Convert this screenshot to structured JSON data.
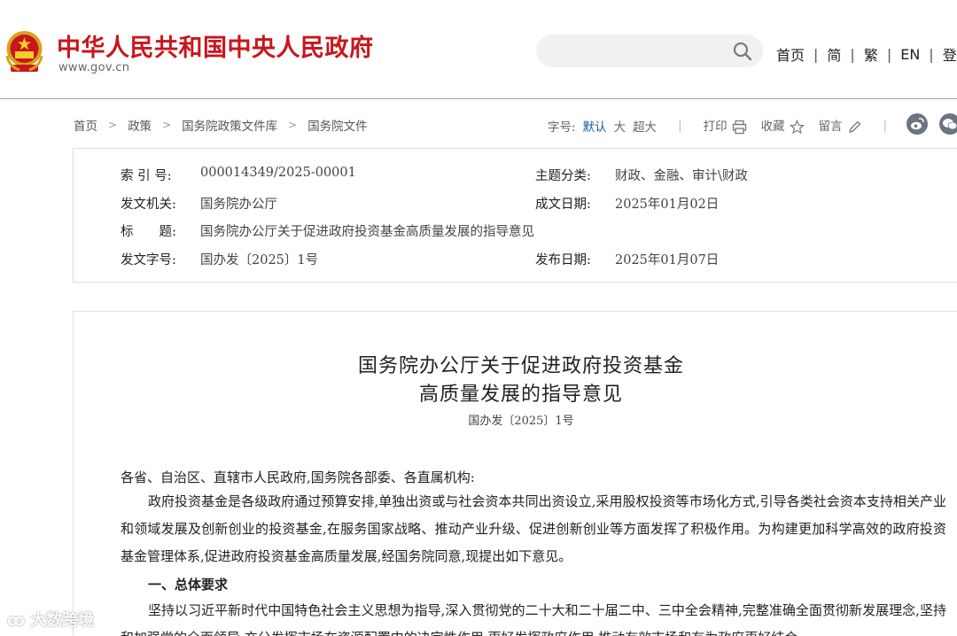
{
  "header": {
    "site_title": "中华人民共和国中央人民政府",
    "site_url": "www.gov.cn",
    "search": {
      "placeholder": ""
    },
    "links": [
      "首页",
      "简",
      "繁",
      "EN",
      "登录"
    ],
    "brand_color": "#c8161d"
  },
  "breadcrumb": [
    "首页",
    "政策",
    "国务院政策文件库",
    "国务院文件"
  ],
  "toolbar": {
    "font_size_label": "字号:",
    "font_default": "默认",
    "font_large": "大",
    "font_xlarge": "超大",
    "print": "打印",
    "favorite": "收藏",
    "comment": "留言"
  },
  "info": {
    "index_label": "索 引 号:",
    "index_value": "000014349/2025-00001",
    "topic_label": "主题分类:",
    "topic_value": "财政、金融、审计\\财政",
    "issuer_label": "发文机关:",
    "issuer_value": "国务院办公厅",
    "written_label": "成文日期:",
    "written_value": "2025年01月02日",
    "title_label": "标　　题:",
    "title_value": "国务院办公厅关于促进政府投资基金高质量发展的指导意见",
    "docno_label": "发文字号:",
    "docno_value": "国办发〔2025〕1号",
    "published_label": "发布日期:",
    "published_value": "2025年01月07日"
  },
  "article": {
    "title_line1": "国务院办公厅关于促进政府投资基金",
    "title_line2": "高质量发展的指导意见",
    "doc_number": "国办发〔2025〕1号",
    "salutation": "各省、自治区、直辖市人民政府,国务院各部委、各直属机构:",
    "paragraph1": "政府投资基金是各级政府通过预算安排,单独出资或与社会资本共同出资设立,采用股权投资等市场化方式,引导各类社会资本支持相关产业和领域发展及创新创业的投资基金,在服务国家战略、推动产业升级、促进创新创业等方面发挥了积极作用。为构建更加科学高效的政府投资基金管理体系,促进政府投资基金高质量发展,经国务院同意,现提出如下意见。",
    "section1": "一、总体要求",
    "paragraph2": "坚持以习近平新时代中国特色社会主义思想为指导,深入贯彻党的二十大和二十届二中、三中全会精神,完整准确全面贯彻新发展理念,坚持和加强党的全面领导,充分发挥市场在资源配置中的决定性作用,更好发挥政府作用,推动有效市场和有为政府更好结合。"
  },
  "watermark": "大数跨境"
}
